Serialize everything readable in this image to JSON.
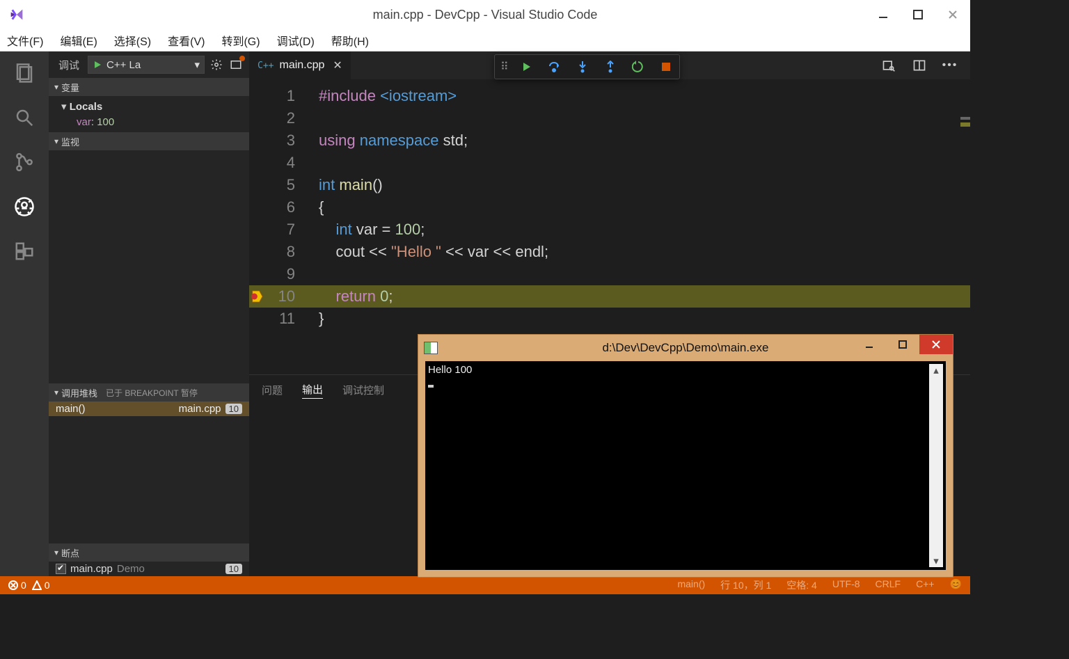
{
  "window": {
    "title": "main.cpp - DevCpp - Visual Studio Code"
  },
  "menu": [
    "文件(F)",
    "编辑(E)",
    "选择(S)",
    "查看(V)",
    "转到(G)",
    "调试(D)",
    "帮助(H)"
  ],
  "sidebar": {
    "title": "调试",
    "launch_label": "C++ La",
    "sections": {
      "vars": {
        "header": "变量",
        "locals_label": "Locals",
        "var_name": "var",
        "var_value": "100"
      },
      "watch": {
        "header": "监视"
      },
      "stack": {
        "header": "调用堆栈",
        "status": "已于 BREAKPOINT 暂停",
        "frame": {
          "fn": "main()",
          "file": "main.cpp",
          "line": "10"
        }
      },
      "bps": {
        "header": "断点",
        "item_file": "main.cpp",
        "item_folder": "Demo",
        "item_line": "10"
      }
    }
  },
  "tab": {
    "name": "main.cpp"
  },
  "code": {
    "lines": {
      "l1a": "#include",
      "l1b": "<iostream>",
      "l3a": "using",
      "l3b": "namespace",
      "l3c": "std",
      "l3d": ";",
      "l5a": "int",
      "l5b": "main",
      "l5c": "()",
      "l6": "{",
      "l7a": "int",
      "l7b": "var",
      "l7c": "=",
      "l7d": "100",
      "l7e": ";",
      "l8a": "cout",
      "l8b": "<<",
      "l8c": "\"Hello \"",
      "l8d": "<<",
      "l8e": "var",
      "l8f": "<<",
      "l8g": "endl",
      "l8h": ";",
      "l10a": "return",
      "l10b": "0",
      "l10c": ";",
      "l11": "}"
    },
    "line_numbers": [
      "1",
      "2",
      "3",
      "4",
      "5",
      "6",
      "7",
      "8",
      "9",
      "10",
      "11"
    ],
    "current_line": 10
  },
  "panel": {
    "tabs": [
      "问题",
      "输出",
      "调试控制"
    ],
    "active": 1
  },
  "status": {
    "errors": "0",
    "warnings": "0",
    "right": [
      "main()",
      "行 10，列 1",
      "空格: 4",
      "UTF-8",
      "CRLF",
      "C++",
      "😊"
    ]
  },
  "console": {
    "title": "d:\\Dev\\DevCpp\\Demo\\main.exe",
    "output": "Hello 100"
  }
}
